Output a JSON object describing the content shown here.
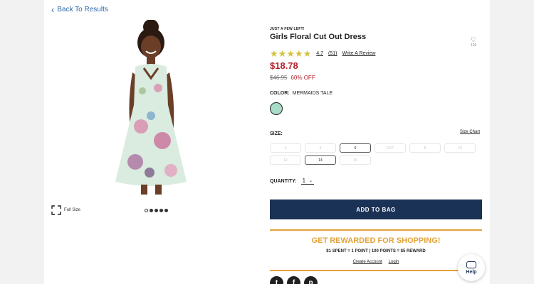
{
  "nav": {
    "back_label": "Back To Results"
  },
  "gallery": {
    "full_size_label": "Full Size",
    "dot_count": 5,
    "active_dot": 0
  },
  "product": {
    "badge": "JUST A FEW LEFT!",
    "title": "Girls Floral Cut Out Dress",
    "favorite_count": "103",
    "rating": "4.7",
    "review_count": "(51)",
    "stars_filled": 5,
    "write_review": "Write A Review",
    "price": "$18.78",
    "original_price": "$46.95",
    "discount": "60% OFF"
  },
  "color": {
    "label": "COLOR:",
    "name": "MERMAIDS TALE",
    "swatch_hex": "#a8dcc8"
  },
  "size": {
    "label": "SIZE:",
    "chart_link": "Size Chart",
    "options": [
      {
        "label": "4",
        "state": "unavailable"
      },
      {
        "label": "5",
        "state": "unavailable"
      },
      {
        "label": "6",
        "state": "available"
      },
      {
        "label": "6X/7",
        "state": "unavailable"
      },
      {
        "label": "8",
        "state": "unavailable"
      },
      {
        "label": "10",
        "state": "unavailable"
      },
      {
        "label": "12",
        "state": "unavailable"
      },
      {
        "label": "14",
        "state": "available"
      },
      {
        "label": "16",
        "state": "unavailable"
      }
    ]
  },
  "quantity": {
    "label": "QUANTITY:",
    "value": "1"
  },
  "cart": {
    "add_label": "ADD TO BAG"
  },
  "rewards": {
    "title": "GET REWARDED FOR SHOPPING!",
    "subtitle": "$1 SPENT = 1 POINT | 100 POINTS = $5 REWARD",
    "create_account": "Create Account",
    "login": "Login"
  },
  "help": {
    "label": "Help"
  },
  "colors": {
    "navy": "#1b3257",
    "sale_red": "#b3202a",
    "reward_gold": "#e3a23a",
    "star_gold": "#d2c23a",
    "link_blue": "#2a6aa8"
  }
}
